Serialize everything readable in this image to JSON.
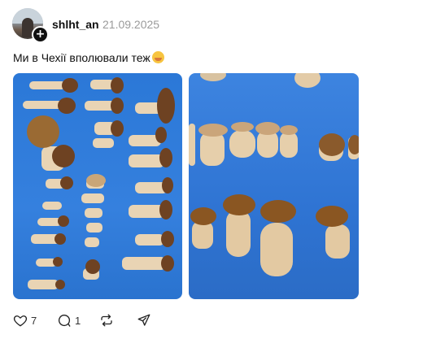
{
  "post": {
    "username": "shlht_an",
    "date": "21.09.2025",
    "text": "Ми в Чехії вполювали теж",
    "emoji": "face-with-hand-over-mouth-emoji"
  },
  "photos": [
    {
      "name": "mushrooms-photo-1",
      "subject": "porcini mushrooms on blue background"
    },
    {
      "name": "mushrooms-photo-2",
      "subject": "porcini mushrooms on blue background close-up"
    }
  ],
  "actions": {
    "like_count": "7",
    "reply_count": "1",
    "like_icon": "heart-icon",
    "reply_icon": "comment-icon",
    "repost_icon": "repost-icon",
    "share_icon": "send-icon"
  },
  "colors": {
    "background": "#ffffff",
    "text": "#101010",
    "muted": "#9a9a9a",
    "photo_bg": "#2f7ad9"
  }
}
